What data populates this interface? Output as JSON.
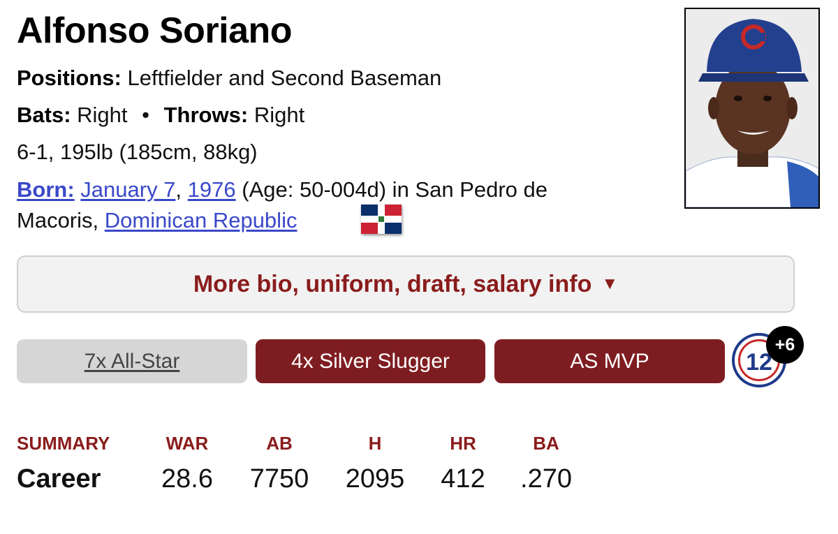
{
  "player": {
    "name": "Alfonso Soriano",
    "positions_label": "Positions:",
    "positions": "Leftfielder and Second Baseman",
    "bats_label": "Bats:",
    "bats": "Right",
    "separator": "•",
    "throws_label": "Throws:",
    "throws": "Right",
    "size": "6-1, 195lb (185cm, 88kg)",
    "born_label": "Born:",
    "born_month_day": "January 7",
    "comma": ",",
    "born_year": "1976",
    "age_text": "(Age: 50-004d) in San Pedro de",
    "birthplace_city": "Macoris,",
    "birthplace_country": "Dominican Republic",
    "flag_icon": "dominican-republic-flag-icon",
    "photo_icon": "player-headshot-cubs-cap"
  },
  "more_info": {
    "label": "More bio, uniform, draft, salary info",
    "arrow": "▼"
  },
  "awards": [
    {
      "label": "7x All-Star",
      "style": "grey"
    },
    {
      "label": "4x Silver Slugger",
      "style": "red"
    },
    {
      "label": "AS MVP",
      "style": "red"
    }
  ],
  "uniform": {
    "number": "12",
    "more_count": "+6"
  },
  "summary": {
    "headers": [
      "SUMMARY",
      "WAR",
      "AB",
      "H",
      "HR",
      "BA"
    ],
    "row_label": "Career",
    "values": [
      "28.6",
      "7750",
      "2095",
      "412",
      ".270"
    ]
  },
  "colors": {
    "accent_red": "#7e1d21",
    "header_red": "#8a1c1c",
    "link_blue": "#3a48c9",
    "grey_pill": "#d6d6d6"
  }
}
